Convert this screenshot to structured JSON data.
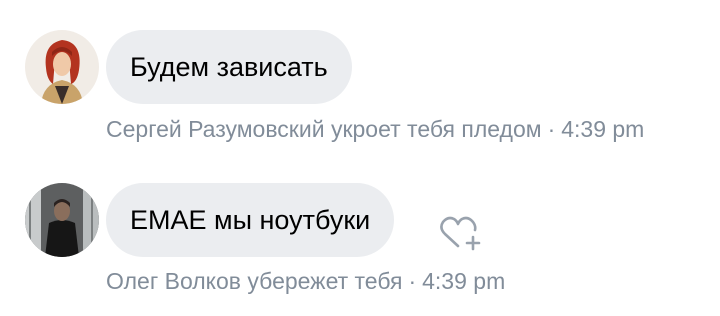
{
  "messages": [
    {
      "avatar_icon": "avatar-red-haired-character",
      "text": "Будем зависать",
      "author": "Сергей Разумовский укроет тебя пледом",
      "time": "4:39 pm"
    },
    {
      "avatar_icon": "avatar-man-in-black-coat",
      "text": "ЕМАЕ мы ноутбуки",
      "author": "Олег Волков убережет тебя",
      "time": "4:39 pm",
      "reaction_icon": "heart-plus-icon"
    }
  ],
  "colors": {
    "bubble": "#ebedf0",
    "meta_text": "#818c99",
    "icon": "#99a2ad"
  }
}
